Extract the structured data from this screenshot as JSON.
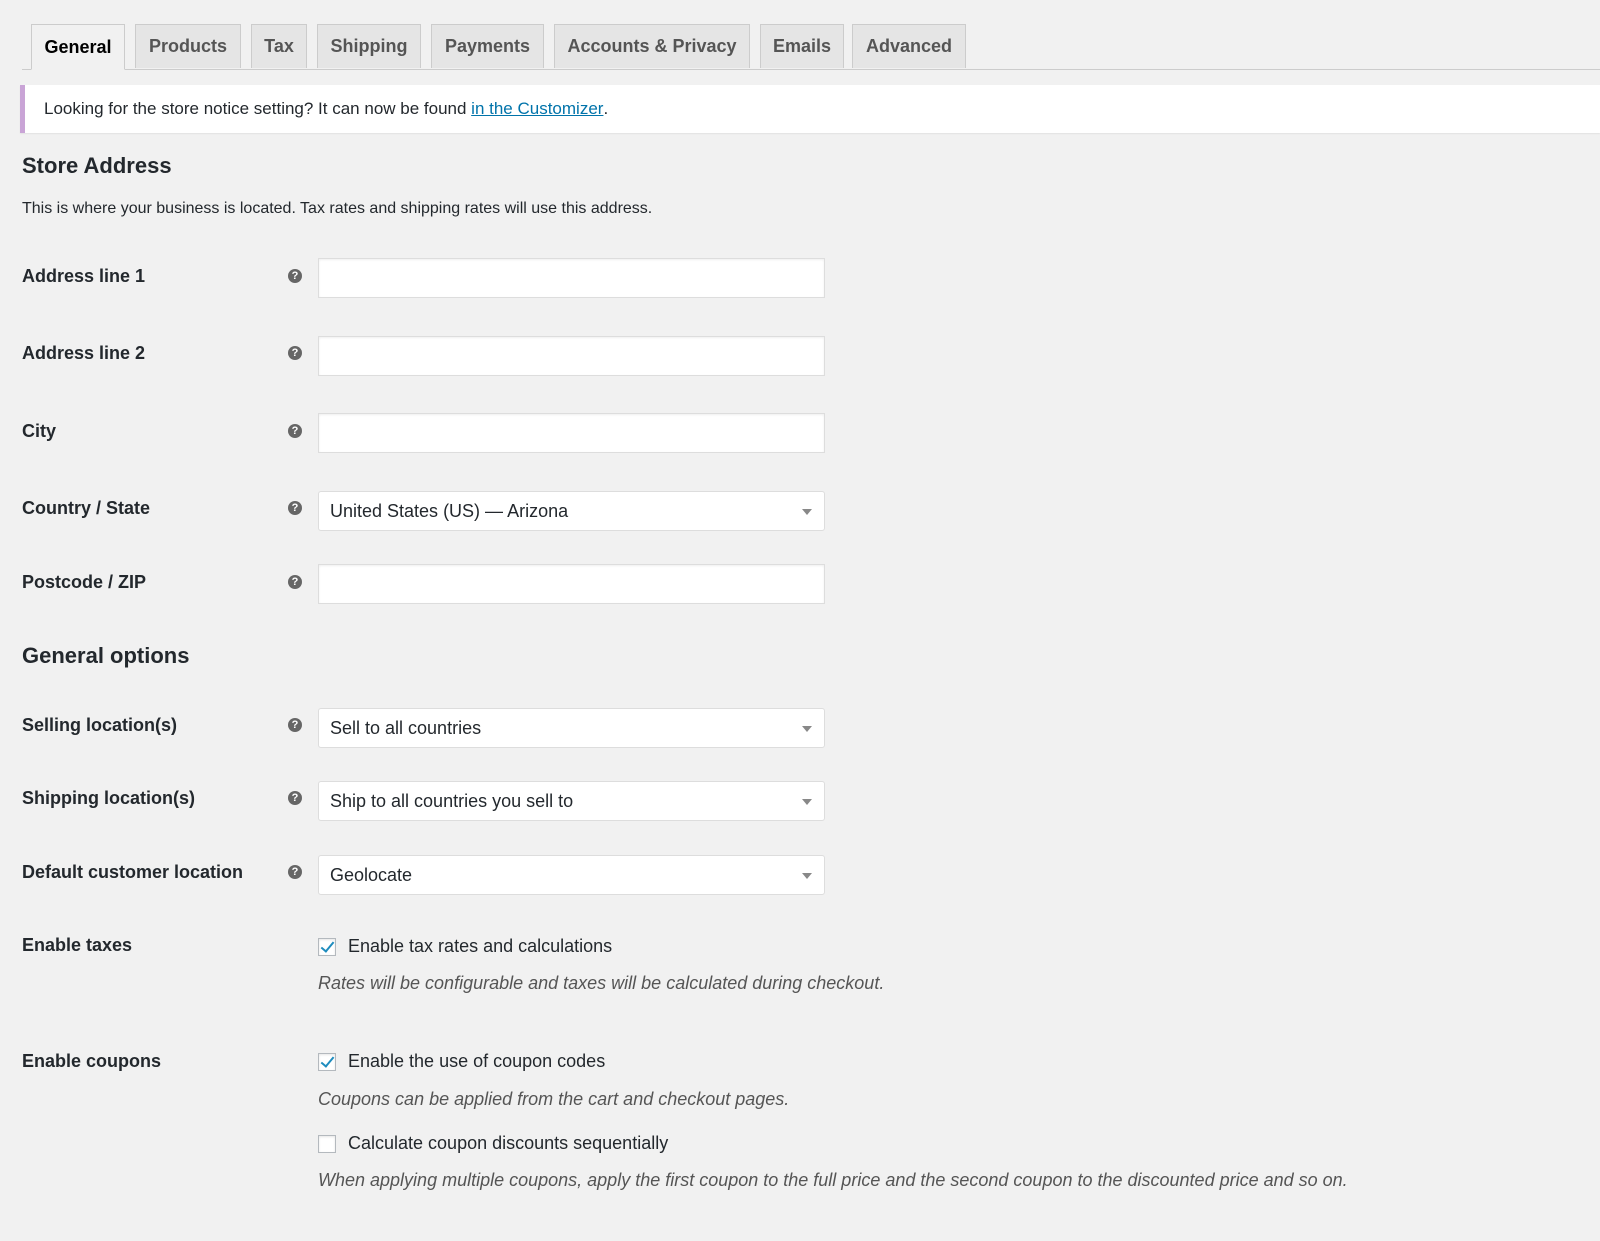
{
  "tabs": [
    {
      "label": "General",
      "active": true
    },
    {
      "label": "Products"
    },
    {
      "label": "Tax"
    },
    {
      "label": "Shipping"
    },
    {
      "label": "Payments"
    },
    {
      "label": "Accounts & Privacy"
    },
    {
      "label": "Emails"
    },
    {
      "label": "Advanced"
    }
  ],
  "notice": {
    "text": "Looking for the store notice setting? It can now be found ",
    "link": "in the Customizer",
    "suffix": "."
  },
  "store_address": {
    "heading": "Store Address",
    "description": "This is where your business is located. Tax rates and shipping rates will use this address.",
    "address1_label": "Address line 1",
    "address1_value": "",
    "address2_label": "Address line 2",
    "address2_value": "",
    "city_label": "City",
    "city_value": "",
    "country_label": "Country / State",
    "country_value": "United States (US) — Arizona",
    "postcode_label": "Postcode / ZIP",
    "postcode_value": ""
  },
  "general_options": {
    "heading": "General options",
    "selling_label": "Selling location(s)",
    "selling_value": "Sell to all countries",
    "shipping_label": "Shipping location(s)",
    "shipping_value": "Ship to all countries you sell to",
    "default_loc_label": "Default customer location",
    "default_loc_value": "Geolocate",
    "taxes_label": "Enable taxes",
    "taxes_checkbox": "Enable tax rates and calculations",
    "taxes_note": "Rates will be configurable and taxes will be calculated during checkout.",
    "coupons_label": "Enable coupons",
    "coupons_checkbox": "Enable the use of coupon codes",
    "coupons_note": "Coupons can be applied from the cart and checkout pages.",
    "sequential_checkbox": "Calculate coupon discounts sequentially",
    "sequential_note": "When applying multiple coupons, apply the first coupon to the full price and the second coupon to the discounted price and so on."
  },
  "icons": {
    "help": "help-icon",
    "caret": "chevron-down-icon",
    "check": "checkmark-icon"
  },
  "colors": {
    "link": "#0073aa",
    "notice_border": "#c9a4d6",
    "check": "#1e8cbe",
    "background": "#f1f1f1"
  }
}
